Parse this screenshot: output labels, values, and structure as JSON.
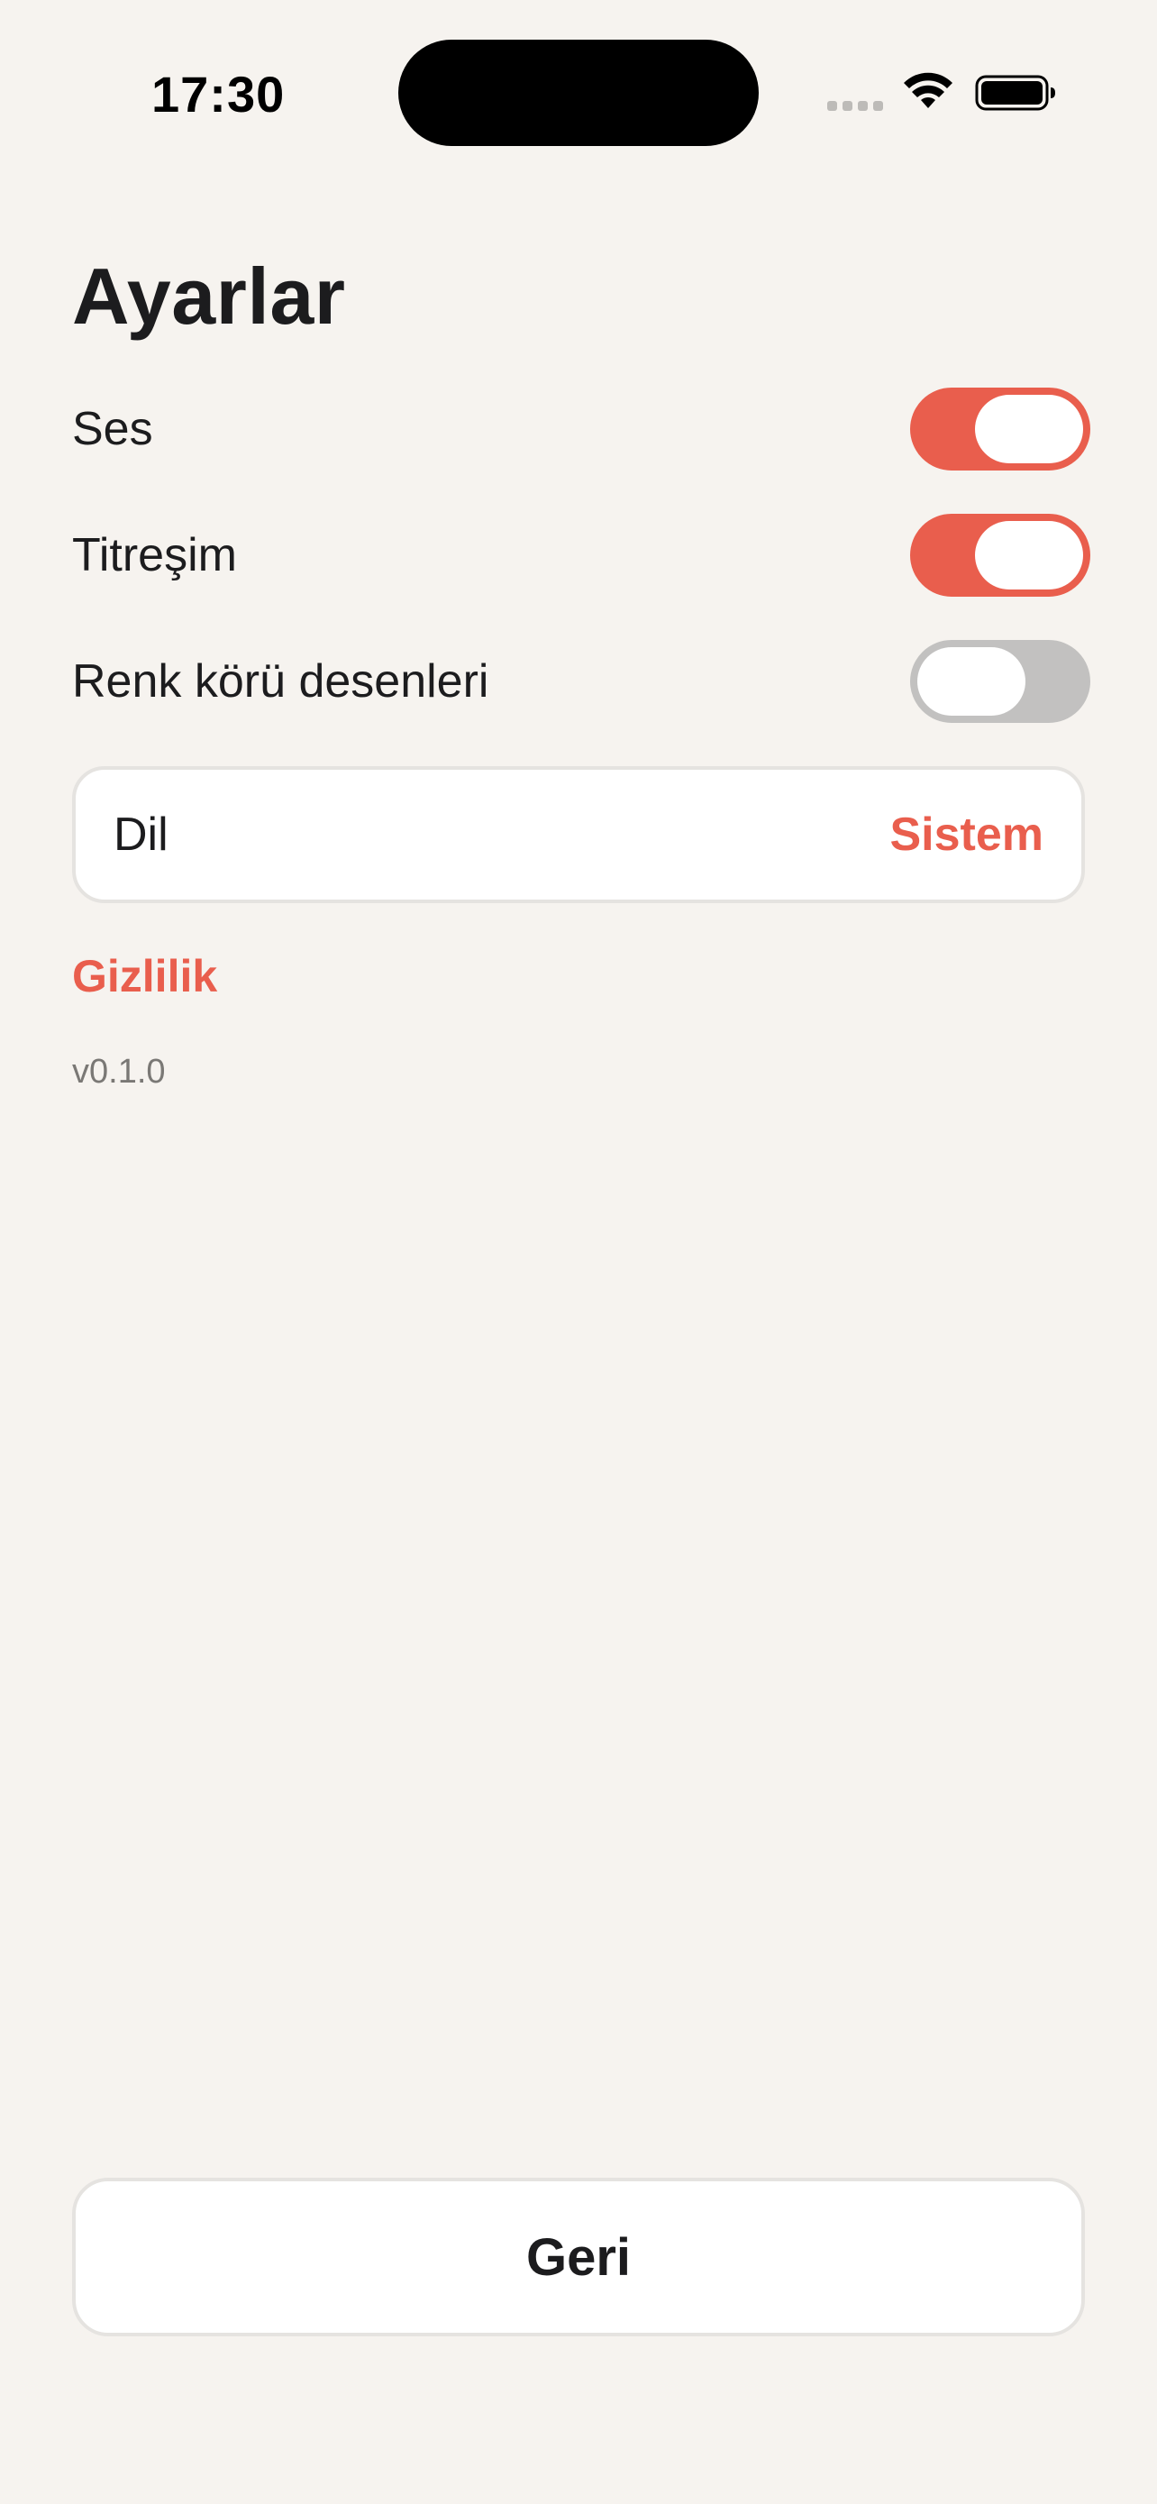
{
  "status_bar": {
    "time": "17:30",
    "icons": [
      "cellular-signal-icon",
      "wifi-icon",
      "battery-icon"
    ]
  },
  "header": {
    "title": "Ayarlar"
  },
  "settings": {
    "sound": {
      "label": "Ses",
      "enabled": true
    },
    "vibration": {
      "label": "Titreşim",
      "enabled": true
    },
    "colorblind_patterns": {
      "label": "Renk körü desenleri",
      "enabled": false
    }
  },
  "language": {
    "label": "Dil",
    "value": "Sistem"
  },
  "privacy": {
    "label": "Gizlilik"
  },
  "version": {
    "text": "v0.1.0"
  },
  "footer": {
    "back_label": "Geri"
  },
  "colors": {
    "background": "#F6F3EF",
    "accent": "#E95E4D",
    "toggle_off": "#C2C1C0",
    "text_primary": "#1C1C1E",
    "text_secondary": "#7A7875"
  }
}
